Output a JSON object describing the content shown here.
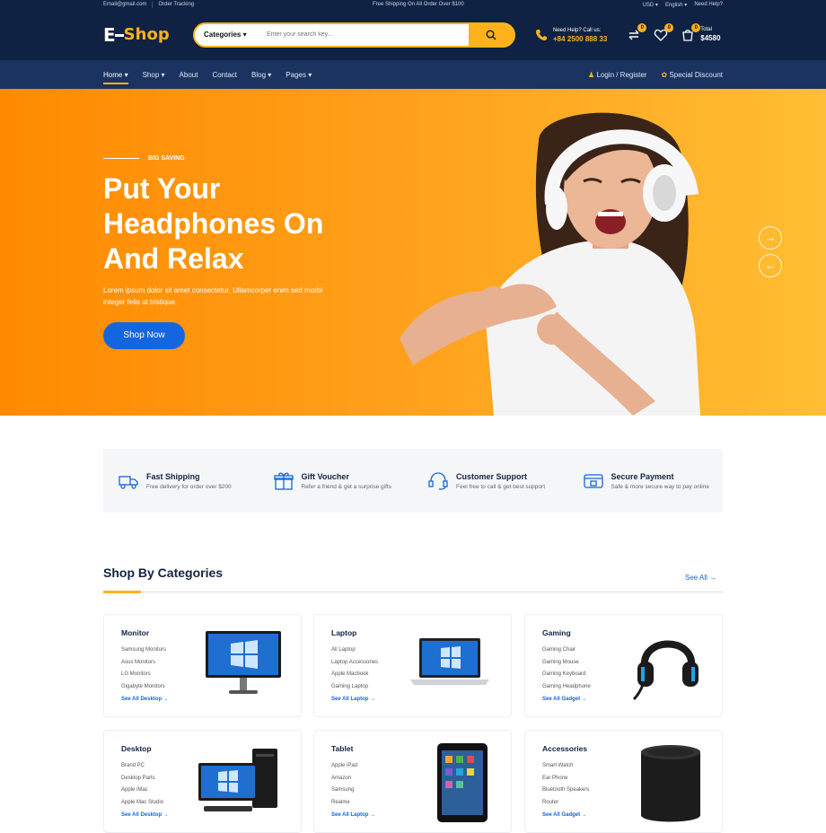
{
  "topbar": {
    "email": "Email@gmail.com",
    "store": "Order Tracking",
    "shipping": "Free Shipping On All Order Over $100",
    "currency": "USD",
    "language": "English",
    "help": "Need Help?"
  },
  "header": {
    "logo_mark": "E",
    "logo_text": "Shop",
    "search_category": "Categories",
    "search_placeholder": "Enter your search key...",
    "hotline_label": "Need Help? Call us:",
    "hotline_number": "+84 2500 888 33",
    "compare_count": "0",
    "wishlist_count": "0",
    "cart_count": "0",
    "cart_total_label": "Total",
    "cart_total_value": "$4580"
  },
  "nav": {
    "items": [
      "Home",
      "Shop",
      "About",
      "Contact",
      "Blog",
      "Pages"
    ],
    "login": "Login / Register",
    "special": "Special Discount"
  },
  "hero": {
    "kicker": "BIG SAVING",
    "title_line1": "Put Your",
    "title_line2": "Headphones On",
    "title_line3": "And Relax",
    "description": "Lorem ipsum dolor sit amet consectetur. Ullamcorper enim sed morbi integer felis ut tristique.",
    "cta": "Shop Now"
  },
  "features": [
    {
      "title": "Fast Shipping",
      "subtitle": "Free delivery for order over $200",
      "icon": "truck-icon"
    },
    {
      "title": "Gift Voucher",
      "subtitle": "Refer a friend & get a surprise gifts",
      "icon": "gift-icon"
    },
    {
      "title": "Customer Support",
      "subtitle": "Feel free to call & get best support",
      "icon": "support-icon"
    },
    {
      "title": "Secure Payment",
      "subtitle": "Safe & more secure way to pay online",
      "icon": "secure-payment-icon"
    }
  ],
  "section": {
    "title": "Shop By Categories",
    "see_all": "See All"
  },
  "categories": [
    {
      "name": "Monitor",
      "items": [
        "Samsung Monitors",
        "Asus Monitors",
        "LG Monitors",
        "Gigabyte Monitors"
      ],
      "link": "See All Desktop"
    },
    {
      "name": "Laptop",
      "items": [
        "All Laptop",
        "Laptop Accessories",
        "Apple Macbook",
        "Gaming Laptop"
      ],
      "link": "See All Laptop"
    },
    {
      "name": "Gaming",
      "items": [
        "Gaming Chair",
        "Gaming Mouse",
        "Gaming Keyboard",
        "Gaming Headphone"
      ],
      "link": "See All Gadget"
    },
    {
      "name": "Desktop",
      "items": [
        "Brand PC",
        "Desktop Parts",
        "Apple iMac",
        "Apple Mac Studio"
      ],
      "link": "See All Desktop"
    },
    {
      "name": "Tablet",
      "items": [
        "Apple iPad",
        "Amazon",
        "Samsung",
        "Realme"
      ],
      "link": "See All Laptop"
    },
    {
      "name": "Accessories",
      "items": [
        "Smart Watch",
        "Ear Phone",
        "Bluetooth Speakers",
        "Router"
      ],
      "link": "See All Gadget"
    }
  ],
  "colors": {
    "navy": "#0f2243",
    "accent": "#ffb21a",
    "primary": "#1466e0",
    "hero_orange": "#ff8a00"
  }
}
